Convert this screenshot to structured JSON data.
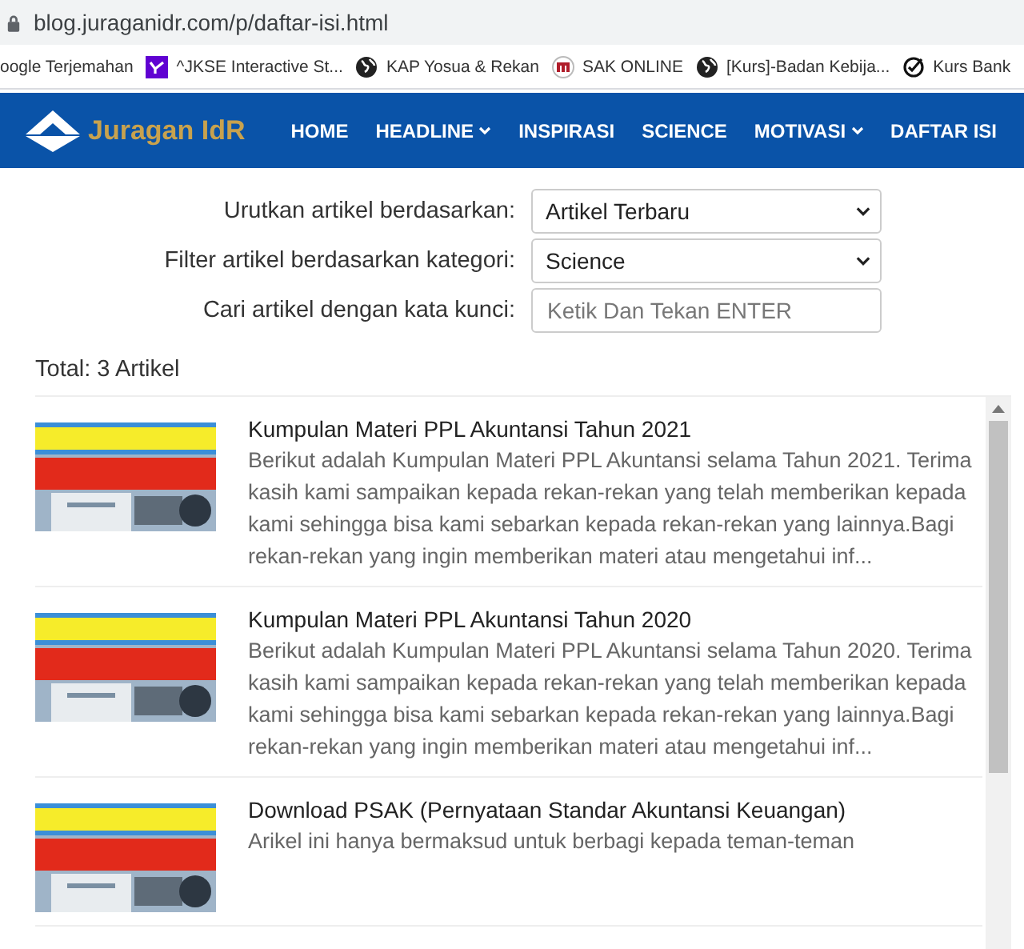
{
  "browser": {
    "url": "blog.juraganidr.com/p/daftar-isi.html",
    "bookmarks": [
      {
        "label": "oogle Terjemahan",
        "kind": "none"
      },
      {
        "label": "^JKSE Interactive St...",
        "kind": "yahoo"
      },
      {
        "label": "KAP Yosua & Rekan",
        "kind": "globe"
      },
      {
        "label": "SAK ONLINE",
        "kind": "sak"
      },
      {
        "label": "[Kurs]-Badan Kebija...",
        "kind": "globe"
      },
      {
        "label": "Kurs Bank",
        "kind": "check"
      }
    ]
  },
  "navbar": {
    "logo": "Juragan IdR",
    "items": [
      {
        "label": "HOME",
        "dropdown": false
      },
      {
        "label": "HEADLINE",
        "dropdown": true
      },
      {
        "label": "INSPIRASI",
        "dropdown": false
      },
      {
        "label": "SCIENCE",
        "dropdown": false
      },
      {
        "label": "MOTIVASI",
        "dropdown": true
      },
      {
        "label": "DAFTAR ISI",
        "dropdown": false
      }
    ]
  },
  "filters": [
    {
      "kind": "select",
      "label": "Urutkan artikel berdasarkan:",
      "value": "Artikel Terbaru"
    },
    {
      "kind": "select",
      "label": "Filter artikel berdasarkan kategori:",
      "value": "Science"
    },
    {
      "kind": "input",
      "label": "Cari artikel dengan kata kunci:",
      "placeholder": "Ketik Dan Tekan ENTER"
    }
  ],
  "total": "Total: 3 Artikel",
  "articles": [
    {
      "title": "Kumpulan Materi PPL Akuntansi Tahun 2021",
      "excerpt": "Berikut adalah Kumpulan Materi PPL Akuntansi selama Tahun 2021. Terima kasih kami sampaikan kepada rekan-rekan yang telah memberikan kepada kami sehingga bisa kami sebarkan kepada rekan-rekan yang lainnya.Bagi rekan-rekan yang ingin memberikan materi atau mengetahui inf..."
    },
    {
      "title": "Kumpulan Materi PPL Akuntansi Tahun 2020",
      "excerpt": "Berikut adalah Kumpulan Materi PPL Akuntansi selama Tahun 2020. Terima kasih kami sampaikan kepada rekan-rekan yang telah memberikan kepada kami sehingga bisa kami sebarkan kepada rekan-rekan yang lainnya.Bagi rekan-rekan yang ingin memberikan materi atau mengetahui inf..."
    },
    {
      "title": "Download PSAK (Pernyataan Standar Akuntansi Keuangan)",
      "excerpt": "Arikel ini hanya bermaksud untuk berbagi kepada teman-teman"
    }
  ]
}
